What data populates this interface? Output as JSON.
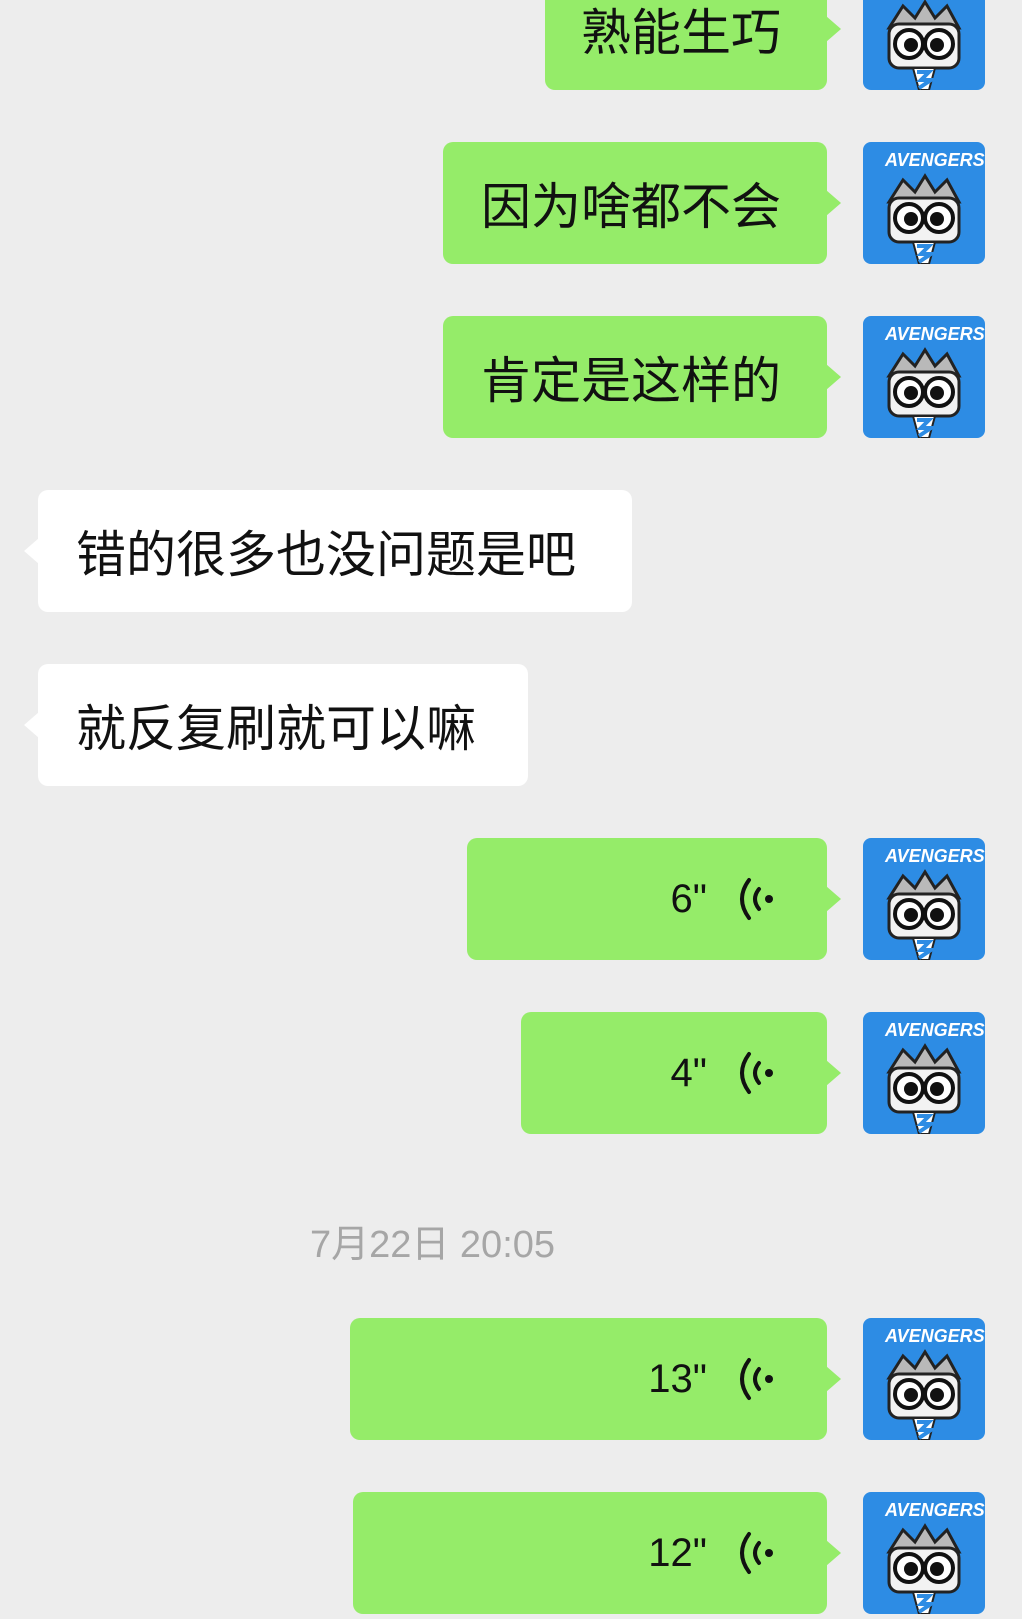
{
  "chat": {
    "messages": [
      {
        "dir": "out",
        "type": "text",
        "text": "熟能生巧"
      },
      {
        "dir": "out",
        "type": "text",
        "text": "因为啥都不会"
      },
      {
        "dir": "out",
        "type": "text",
        "text": "肯定是这样的"
      },
      {
        "dir": "in",
        "type": "text",
        "text": "错的很多也没问题是吧"
      },
      {
        "dir": "in",
        "type": "text",
        "text": "就反复刷就可以嘛"
      },
      {
        "dir": "out",
        "type": "voice",
        "duration": "6\""
      },
      {
        "dir": "out",
        "type": "voice",
        "duration": "4\""
      },
      {
        "dir": "out",
        "type": "voice",
        "duration": "13\""
      },
      {
        "dir": "out",
        "type": "voice",
        "duration": "12\""
      }
    ],
    "timestamp": "7月22日 20:05",
    "avatar_text": "AVENGERS",
    "colors": {
      "outgoing": "#95ec69",
      "incoming": "#ffffff",
      "background": "#ededed",
      "avatar": "#2d8ce4"
    }
  }
}
